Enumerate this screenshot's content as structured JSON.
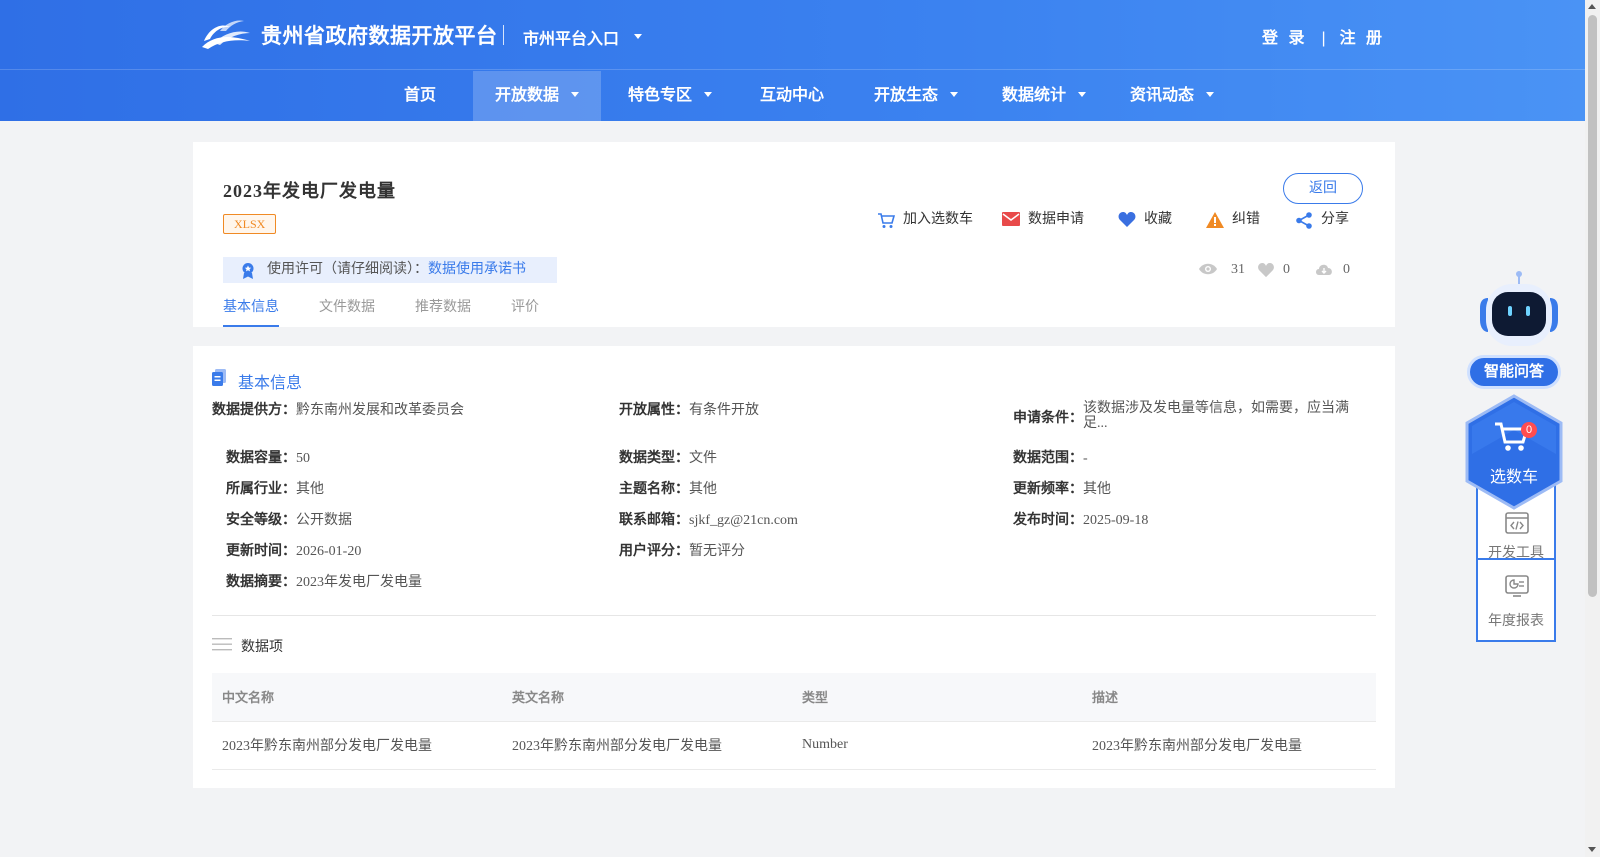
{
  "header": {
    "site_title": "贵州省政府数据开放平台",
    "city_entry": "市州平台入口",
    "login": "登 录",
    "auth_sep": "|",
    "register": "注 册"
  },
  "nav": {
    "items": [
      {
        "label": "首页"
      },
      {
        "label": "开放数据"
      },
      {
        "label": "特色专区"
      },
      {
        "label": "互动中心"
      },
      {
        "label": "开放生态"
      },
      {
        "label": "数据统计"
      },
      {
        "label": "资讯动态"
      }
    ],
    "active": "开放数据"
  },
  "dataset": {
    "title": "2023年发电厂发电量",
    "format": "XLSX",
    "back": "返回",
    "actions": {
      "add_cart": "加入选数车",
      "apply": "数据申请",
      "favorite": "收藏",
      "report_error": "纠错",
      "share": "分享"
    },
    "license_prefix": "使用许可（请仔细阅读）：",
    "license_link": "数据使用承诺书",
    "stats": {
      "views": "31",
      "likes": "0",
      "downloads": "0"
    },
    "tabs": [
      "基本信息",
      "文件数据",
      "推荐数据",
      "评价"
    ]
  },
  "basic_info": {
    "section_title": "基本信息",
    "fields": {
      "provider": {
        "label": "数据提供方：",
        "value": "黔东南州发展和改革委员会"
      },
      "open_attr": {
        "label": "开放属性：",
        "value": "有条件开放"
      },
      "apply_cond": {
        "label": "申请条件：",
        "value": "该数据涉及发电量等信息，如需要，应当满足..."
      },
      "capacity": {
        "label": "数据容量：",
        "value": "50"
      },
      "data_type": {
        "label": "数据类型：",
        "value": "文件"
      },
      "data_range": {
        "label": "数据范围：",
        "value": "-"
      },
      "industry": {
        "label": "所属行业：",
        "value": "其他"
      },
      "topic": {
        "label": "主题名称：",
        "value": "其他"
      },
      "frequency": {
        "label": "更新频率：",
        "value": "其他"
      },
      "security": {
        "label": "安全等级：",
        "value": "公开数据"
      },
      "email": {
        "label": "联系邮箱：",
        "value": "sjkf_gz@21cn.com"
      },
      "publish_time": {
        "label": "发布时间：",
        "value": "2025-09-18"
      },
      "update_time": {
        "label": "更新时间：",
        "value": "2026-01-20"
      },
      "rating": {
        "label": "用户评分：",
        "value": "暂无评分"
      },
      "summary": {
        "label": "数据摘要：",
        "value": "2023年发电厂发电量"
      }
    },
    "items_title": "数据项",
    "table": {
      "headers": [
        "中文名称",
        "英文名称",
        "类型",
        "描述"
      ],
      "rows": [
        [
          "2023年黔东南州部分发电厂发电量",
          "2023年黔东南州部分发电厂发电量",
          "Number",
          "2023年黔东南州部分发电厂发电量"
        ]
      ]
    }
  },
  "sidebar": {
    "ask": "智能问答",
    "cart": "选数车",
    "cart_count": "0",
    "dev_tools": "开发工具",
    "annual_report": "年度报表"
  },
  "colors": {
    "brand_blue": "#3a7bea",
    "header_gradient_start": "#2f6fe6",
    "header_gradient_end": "#4a93f5",
    "format_tag": "#f08a24"
  }
}
